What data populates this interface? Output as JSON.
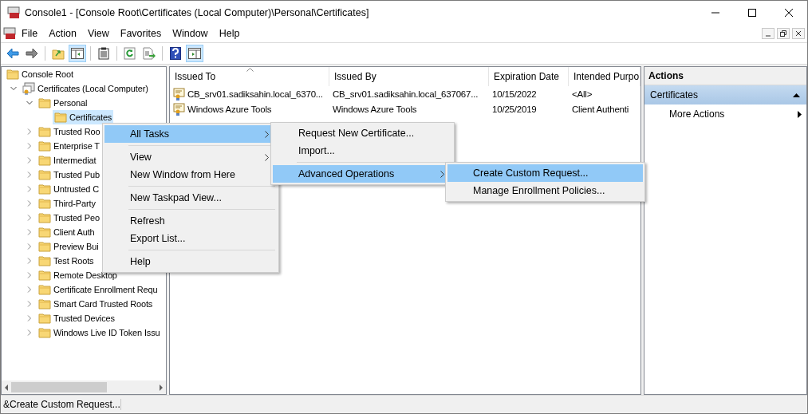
{
  "window": {
    "title": "Console1 - [Console Root\\Certificates (Local Computer)\\Personal\\Certificates]"
  },
  "menubar": [
    "File",
    "Action",
    "View",
    "Favorites",
    "Window",
    "Help"
  ],
  "toolbar": [
    {
      "kind": "back",
      "pressed": false
    },
    {
      "kind": "forward",
      "pressed": false
    },
    {
      "kind": "sep"
    },
    {
      "kind": "up",
      "pressed": false
    },
    {
      "kind": "tree",
      "pressed": true
    },
    {
      "kind": "sep"
    },
    {
      "kind": "properties",
      "pressed": false
    },
    {
      "kind": "sep"
    },
    {
      "kind": "refresh",
      "pressed": false
    },
    {
      "kind": "export",
      "pressed": false
    },
    {
      "kind": "sep"
    },
    {
      "kind": "help",
      "pressed": false
    },
    {
      "kind": "actionpane",
      "pressed": true
    }
  ],
  "tree": [
    {
      "label": "Console Root",
      "kind": "folder",
      "selected": false,
      "children": [
        {
          "label": "Certificates (Local Computer)",
          "kind": "snapin",
          "selected": false,
          "expanded": true,
          "children": [
            {
              "label": "Personal",
              "kind": "folder",
              "selected": false,
              "expanded": true,
              "children": [
                {
                  "label": "Certificates",
                  "kind": "folder",
                  "selected": true
                }
              ]
            },
            {
              "label": "Trusted Roo",
              "kind": "folder",
              "selected": false,
              "expanded": false
            },
            {
              "label": "Enterprise T",
              "kind": "folder",
              "selected": false,
              "expanded": false
            },
            {
              "label": "Intermediat",
              "kind": "folder",
              "selected": false,
              "expanded": false
            },
            {
              "label": "Trusted Pub",
              "kind": "folder",
              "selected": false,
              "expanded": false
            },
            {
              "label": "Untrusted C",
              "kind": "folder",
              "selected": false,
              "expanded": false
            },
            {
              "label": "Third-Party",
              "kind": "folder",
              "selected": false,
              "expanded": false
            },
            {
              "label": "Trusted Peo",
              "kind": "folder",
              "selected": false,
              "expanded": false
            },
            {
              "label": "Client Auth",
              "kind": "folder",
              "selected": false,
              "expanded": false
            },
            {
              "label": "Preview Bui",
              "kind": "folder",
              "selected": false,
              "expanded": false
            },
            {
              "label": "Test Roots",
              "kind": "folder",
              "selected": false,
              "expanded": false
            },
            {
              "label": "Remote Desktop",
              "kind": "folder",
              "selected": false,
              "expanded": false
            },
            {
              "label": "Certificate Enrollment Requ",
              "kind": "folder",
              "selected": false,
              "expanded": false
            },
            {
              "label": "Smart Card Trusted Roots",
              "kind": "folder",
              "selected": false,
              "expanded": false
            },
            {
              "label": "Trusted Devices",
              "kind": "folder",
              "selected": false,
              "expanded": false
            },
            {
              "label": "Windows Live ID Token Issu",
              "kind": "folder",
              "selected": false,
              "expanded": false
            }
          ]
        }
      ]
    }
  ],
  "table": {
    "columns": [
      {
        "label": "Issued To",
        "sorted": true
      },
      {
        "label": "Issued By",
        "sorted": false
      },
      {
        "label": "Expiration Date",
        "sorted": false
      },
      {
        "label": "Intended Purpo",
        "sorted": false
      }
    ],
    "rows": [
      [
        "CB_srv01.sadiksahin.local_6370...",
        "CB_srv01.sadiksahin.local_637067...",
        "10/15/2022",
        "<All>"
      ],
      [
        "Windows Azure Tools",
        "Windows Azure Tools",
        "10/25/2019",
        "Client Authenti"
      ]
    ]
  },
  "actions": {
    "title": "Actions",
    "section": {
      "label": "Certificates",
      "expanded": true
    },
    "items": [
      "More Actions"
    ]
  },
  "menus": [
    [
      {
        "kind": "item",
        "label": "All Tasks",
        "submenu": true,
        "selected": true
      },
      {
        "kind": "separator"
      },
      {
        "kind": "item",
        "label": "View",
        "submenu": true,
        "selected": false
      },
      {
        "kind": "item",
        "label": "New Window from Here",
        "submenu": false,
        "selected": false
      },
      {
        "kind": "separator"
      },
      {
        "kind": "item",
        "label": "New Taskpad View...",
        "submenu": false,
        "selected": false
      },
      {
        "kind": "separator"
      },
      {
        "kind": "item",
        "label": "Refresh",
        "submenu": false,
        "selected": false
      },
      {
        "kind": "item",
        "label": "Export List...",
        "submenu": false,
        "selected": false
      },
      {
        "kind": "separator"
      },
      {
        "kind": "item",
        "label": "Help",
        "submenu": false,
        "selected": false
      }
    ],
    [
      {
        "kind": "item",
        "label": "Request New Certificate...",
        "submenu": false,
        "selected": false
      },
      {
        "kind": "item",
        "label": "Import...",
        "submenu": false,
        "selected": false
      },
      {
        "kind": "separator"
      },
      {
        "kind": "item",
        "label": "Advanced Operations",
        "submenu": true,
        "selected": true
      }
    ],
    [
      {
        "kind": "item",
        "label": "Create Custom Request...",
        "submenu": false,
        "selected": true
      },
      {
        "kind": "item",
        "label": "Manage Enrollment Policies...",
        "submenu": false,
        "selected": false
      }
    ]
  ],
  "status_bar": "&Create Custom Request..."
}
